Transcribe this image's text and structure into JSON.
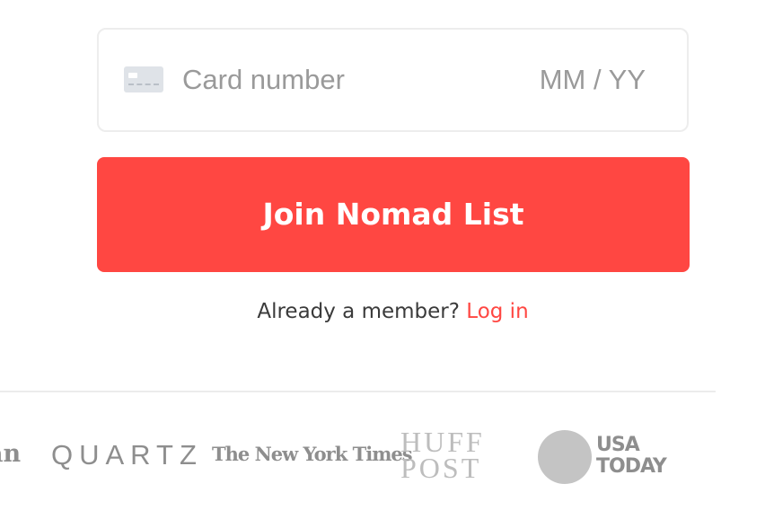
{
  "payment": {
    "card_number_placeholder": "Card number",
    "expiry_placeholder": "MM / YY",
    "card_icon": "credit-card-icon"
  },
  "cta": {
    "join_label": "Join Nomad List",
    "color": "#ff4742"
  },
  "member": {
    "prompt": "Already a member?",
    "login_label": "Log in"
  },
  "press_logos": {
    "guardian_fragment": "an",
    "quartz": "QUARTZ",
    "nyt": "The New York Times",
    "huffpost_line1": "HUFF",
    "huffpost_line2": "POST",
    "usatoday_line1": "USA",
    "usatoday_line2": "TODAY"
  }
}
